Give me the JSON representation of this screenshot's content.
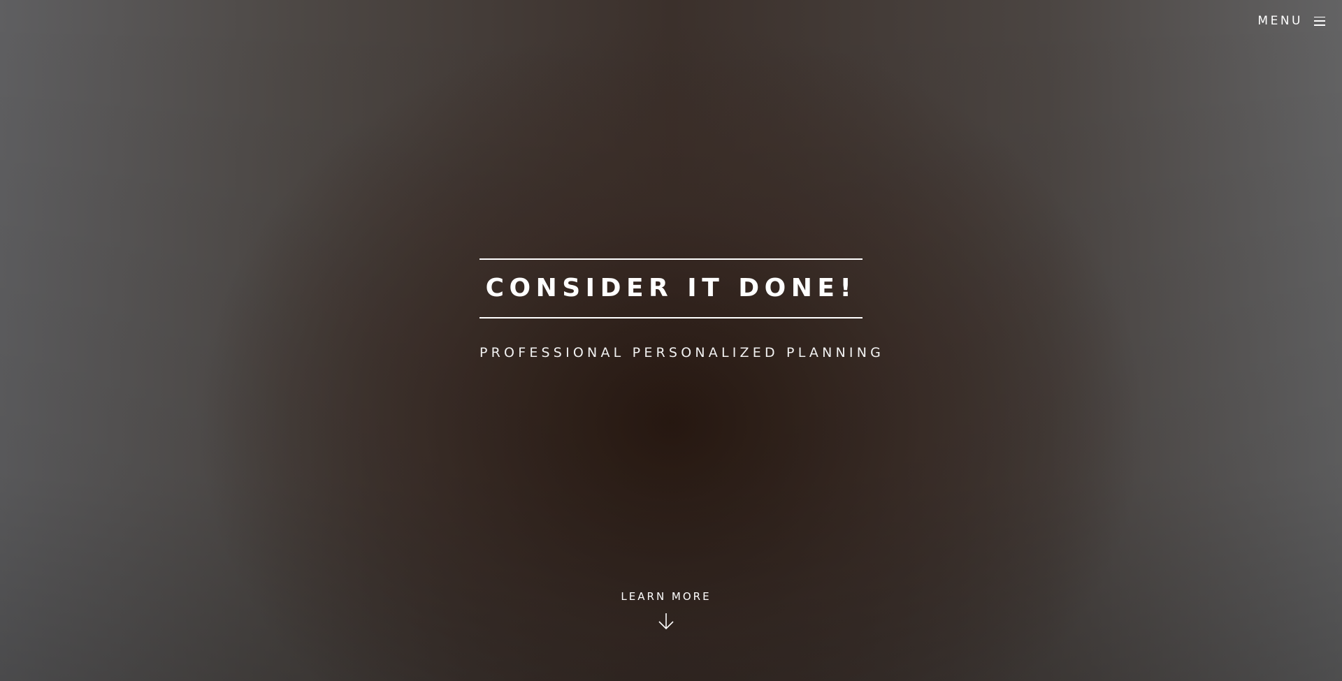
{
  "nav": {
    "menu_label": "MENU",
    "menu_icon": "hamburger-icon"
  },
  "hero": {
    "headline": "CONSIDER IT DONE!",
    "subtitle": "PROFESSIONAL PERSONALIZED PLANNING"
  },
  "cta": {
    "label": "LEARN MORE",
    "icon": "arrow-down-icon"
  },
  "colors": {
    "text": "#ffffff",
    "background_center": "#2b1f18",
    "background_edge": "#626263"
  }
}
